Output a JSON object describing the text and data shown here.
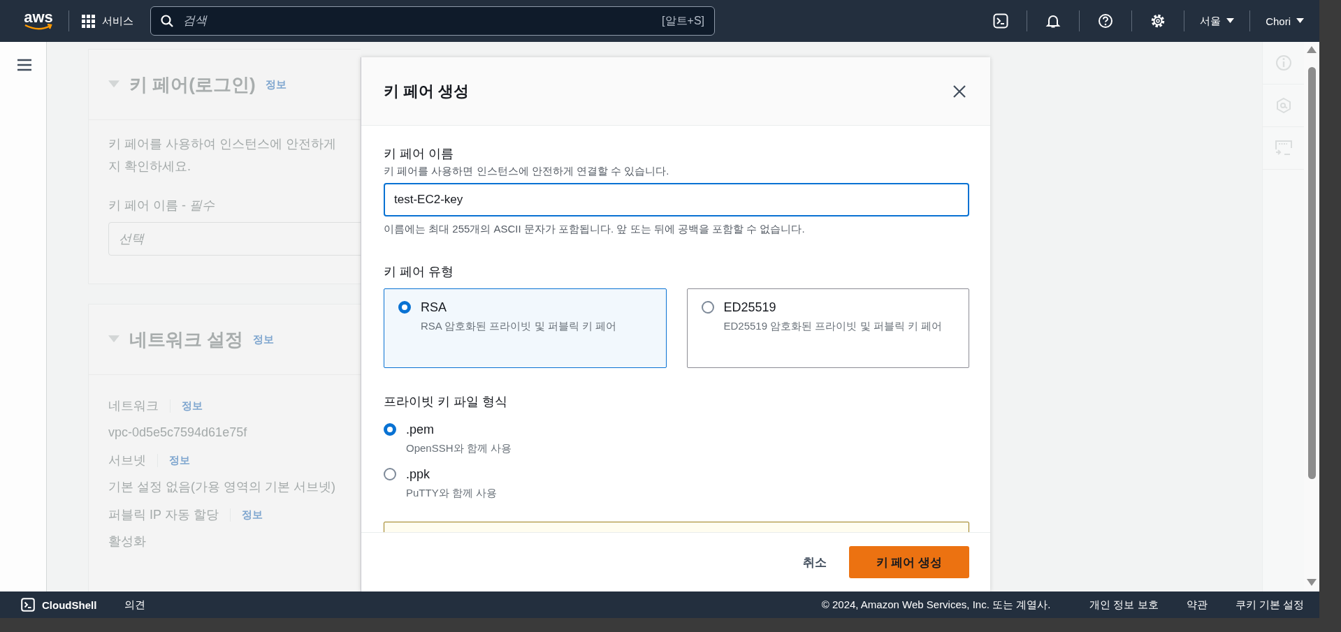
{
  "top_nav": {
    "logo": "aws",
    "services_label": "서비스",
    "search": {
      "placeholder": "검색",
      "shortcut": "[알트+S]"
    },
    "region": "서울",
    "user": "Chori"
  },
  "background": {
    "key_pair_section": {
      "title": "키 페어(로그인)",
      "info_link": "정보",
      "description_lines": [
        "키 페어를 사용하여 인스턴스에 안전하게",
        "지 확인하세요."
      ],
      "field_label": "키 페어 이름 - *필수*",
      "field_placeholder": "선택"
    },
    "network_section": {
      "title": "네트워크 설정",
      "info_link": "정보",
      "fields": [
        {
          "label": "네트워크",
          "info_link": "정보",
          "value": "vpc-0d5e5c7594d61e75f"
        },
        {
          "label": "서브넷",
          "info_link": "정보",
          "value": "기본 설정 없음(가용 영역의 기본 서브넷)"
        },
        {
          "label": "퍼블릭 IP 자동 할당",
          "info_link": "정보",
          "value": "활성화"
        }
      ]
    }
  },
  "modal": {
    "title": "키 페어 생성",
    "name_field": {
      "label": "키 페어 이름",
      "description": "키 페어를 사용하면 인스턴스에 안전하게 연결할 수 있습니다.",
      "value": "test-EC2-key",
      "constraint": "이름에는 최대 255개의 ASCII 문자가 포함됩니다. 앞 또는 뒤에 공백을 포함할 수 없습니다."
    },
    "type_group": {
      "label": "키 페어 유형",
      "options": [
        {
          "label": "RSA",
          "description": "RSA 암호화된 프라이빗 및 퍼블릭 키 페어",
          "selected": true
        },
        {
          "label": "ED25519",
          "description": "ED25519 암호화된 프라이빗 및 퍼블릭 키 페어",
          "selected": false
        }
      ]
    },
    "format_group": {
      "label": "프라이빗 키 파일 형식",
      "options": [
        {
          "label": ".pem",
          "description": "OpenSSH와 함께 사용",
          "selected": true
        },
        {
          "label": ".ppk",
          "description": "PuTTY와 함께 사용",
          "selected": false
        }
      ]
    },
    "buttons": [
      {
        "label": "취소",
        "kind": "link"
      },
      {
        "label": "키 페어 생성",
        "kind": "primary"
      }
    ]
  },
  "footer": {
    "cloudshell": "CloudShell",
    "feedback": "의견",
    "copyright": "© 2024, Amazon Web Services, Inc. 또는 계열사.",
    "links": [
      "개인 정보 보호",
      "약관",
      "쿠키 기본 설정"
    ]
  }
}
